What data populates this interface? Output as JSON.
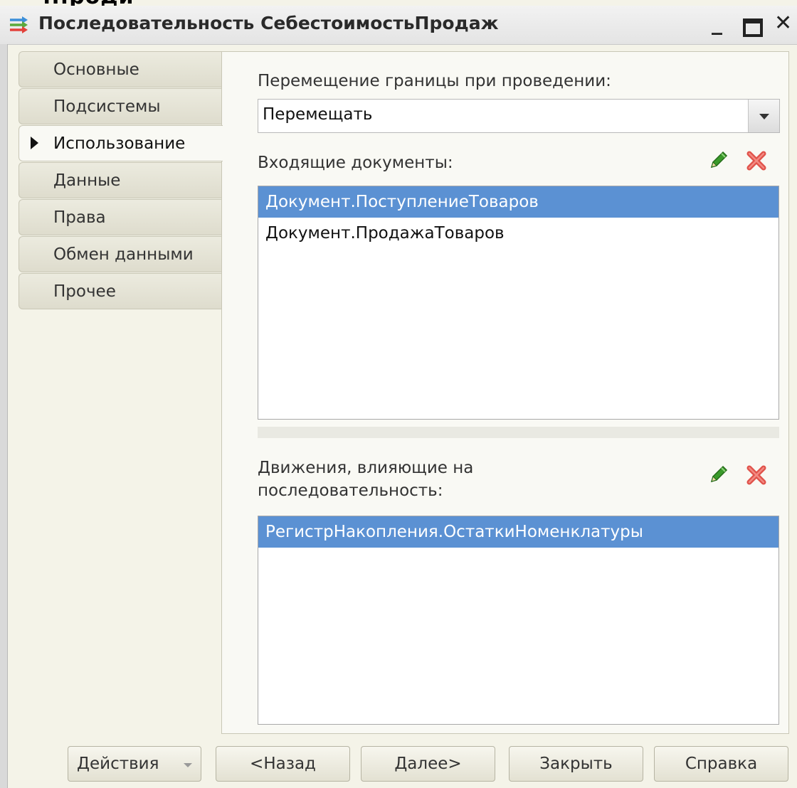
{
  "window": {
    "top_fragment": "...роди",
    "title": "Последовательность СебестоимостьПродаж",
    "minimize_glyph": "_",
    "close_glyph": "✕"
  },
  "tabs": [
    {
      "label": "Основные",
      "active": false
    },
    {
      "label": "Подсистемы",
      "active": false
    },
    {
      "label": "Использование",
      "active": true
    },
    {
      "label": "Данные",
      "active": false
    },
    {
      "label": "Права",
      "active": false
    },
    {
      "label": "Обмен данными",
      "active": false
    },
    {
      "label": "Прочее",
      "active": false
    }
  ],
  "usage": {
    "border_move_label": "Перемещение границы при проведении:",
    "border_move_value": "Перемещать",
    "incoming_docs_label": "Входящие документы:",
    "incoming_docs": [
      {
        "text": "Документ.ПоступлениеТоваров",
        "selected": true
      },
      {
        "text": "Документ.ПродажаТоваров",
        "selected": false
      }
    ],
    "movements_label_line1": "Движения, влияющие на",
    "movements_label_line2": "последовательность:",
    "movements": [
      {
        "text": "РегистрНакопления.ОстаткиНоменклатуры",
        "selected": true
      }
    ]
  },
  "buttons": {
    "actions": "Действия",
    "back": "<Назад",
    "next": "Далее>",
    "close": "Закрыть",
    "help": "Справка"
  },
  "colors": {
    "selection": "#5b91d3",
    "edit_icon": "#3a9a2a",
    "delete_icon": "#e0524a"
  },
  "icons": {
    "title": "sequence-icon",
    "edit": "pencil-icon",
    "delete": "delete-x-icon",
    "dropdown": "chevron-down-icon"
  }
}
